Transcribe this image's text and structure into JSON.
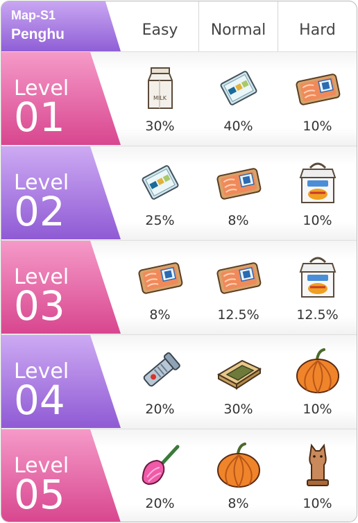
{
  "header": {
    "map_code": "Map-S1",
    "map_name": "Penghu",
    "columns": [
      "Easy",
      "Normal",
      "Hard"
    ]
  },
  "colors": {
    "purple": "#a478e0",
    "pink": "#e0589a",
    "grid": "#d6d6d6"
  },
  "levels": [
    {
      "word": "Level",
      "number": "01",
      "tab_color": "pink",
      "drops": [
        {
          "icon": "milk-carton-icon",
          "rate": "30%"
        },
        {
          "icon": "food-packet-icon",
          "rate": "40%"
        },
        {
          "icon": "salmon-tray-icon",
          "rate": "10%"
        }
      ]
    },
    {
      "word": "Level",
      "number": "02",
      "tab_color": "purple",
      "drops": [
        {
          "icon": "food-packet-icon",
          "rate": "25%"
        },
        {
          "icon": "salmon-tray-icon",
          "rate": "8%"
        },
        {
          "icon": "bbq-box-icon",
          "rate": "10%"
        }
      ]
    },
    {
      "word": "Level",
      "number": "03",
      "tab_color": "pink",
      "drops": [
        {
          "icon": "salmon-tray-icon",
          "rate": "8%"
        },
        {
          "icon": "salmon-tray-icon",
          "rate": "12.5%"
        },
        {
          "icon": "bbq-box-icon",
          "rate": "12.5%"
        }
      ]
    },
    {
      "word": "Level",
      "number": "04",
      "tab_color": "purple",
      "drops": [
        {
          "icon": "flashlight-icon",
          "rate": "20%"
        },
        {
          "icon": "wooden-tray-icon",
          "rate": "30%"
        },
        {
          "icon": "pumpkin-icon",
          "rate": "10%"
        }
      ]
    },
    {
      "word": "Level",
      "number": "05",
      "tab_color": "pink",
      "drops": [
        {
          "icon": "feather-duster-icon",
          "rate": "20%"
        },
        {
          "icon": "pumpkin-icon",
          "rate": "8%"
        },
        {
          "icon": "cat-statue-icon",
          "rate": "10%"
        }
      ]
    }
  ]
}
